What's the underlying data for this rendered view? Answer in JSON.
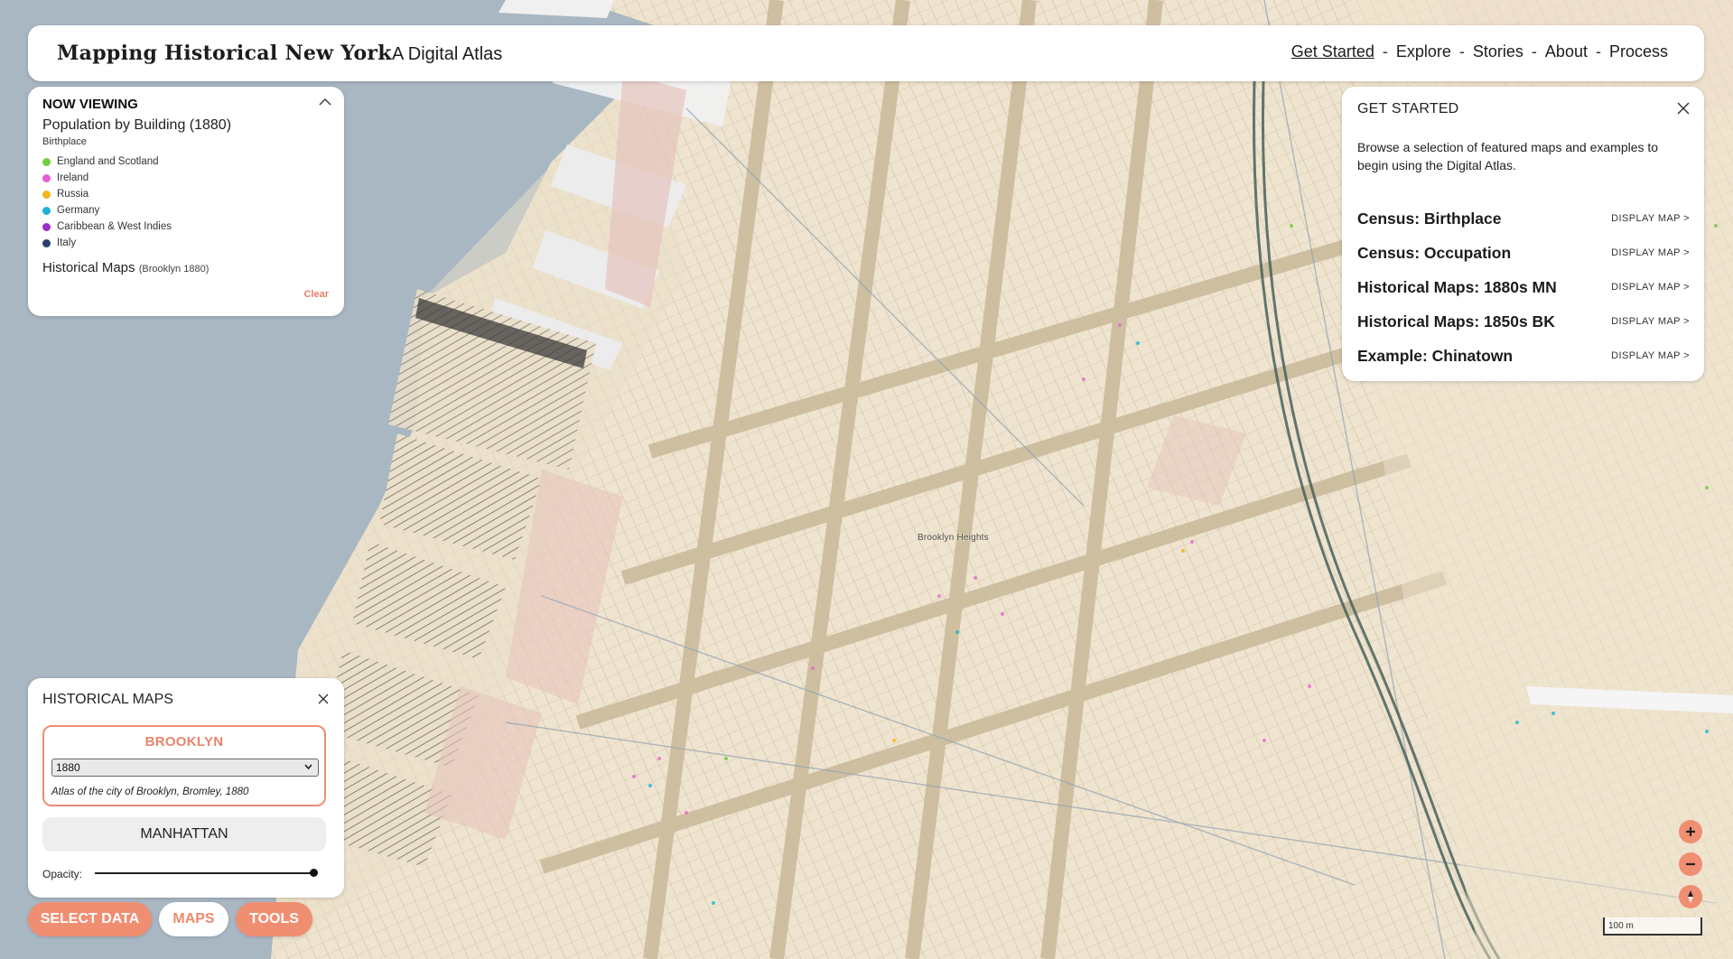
{
  "app": {
    "title": "Mapping Historical New York",
    "subtitle": "A Digital Atlas"
  },
  "nav": {
    "items": [
      "Get Started",
      "Explore",
      "Stories",
      "About",
      "Process"
    ],
    "separator": "-",
    "active_index": 0
  },
  "now_viewing": {
    "heading": "NOW VIEWING",
    "dataset": "Population by Building (1880)",
    "attribute": "Birthplace",
    "legend": [
      {
        "label": "England and Scotland",
        "color": "#6fcf3c"
      },
      {
        "label": "Ireland",
        "color": "#e85fd1"
      },
      {
        "label": "Russia",
        "color": "#f2b51b"
      },
      {
        "label": "Germany",
        "color": "#1fb3d6"
      },
      {
        "label": "Caribbean & West Indies",
        "color": "#9b2fce"
      },
      {
        "label": "Italy",
        "color": "#2d3d6e"
      }
    ],
    "maps_label": "Historical Maps",
    "maps_detail": "(Brooklyn 1880)",
    "clear_label": "Clear"
  },
  "get_started": {
    "heading": "GET STARTED",
    "description": "Browse a selection of featured maps and examples to begin using the Digital Atlas.",
    "action_label": "DISPLAY MAP >",
    "items": [
      "Census: Birthplace",
      "Census: Occupation",
      "Historical Maps: 1880s MN",
      "Historical Maps: 1850s BK",
      "Example: Chinatown"
    ]
  },
  "historical_maps": {
    "heading": "HISTORICAL MAPS",
    "brooklyn_label": "BROOKLYN",
    "selected_year": "1880",
    "source": "Atlas of the city of Brooklyn, Bromley, 1880",
    "manhattan_label": "MANHATTAN",
    "opacity_label": "Opacity:",
    "opacity": 1.0
  },
  "bottom_buttons": {
    "select_data": "SELECT DATA",
    "maps": "MAPS",
    "tools": "TOOLS"
  },
  "map": {
    "place_label": "Brooklyn Heights",
    "scale_label": "100 m"
  },
  "colors": {
    "accent": "#f08e72",
    "water": "#a9b7c3",
    "paper": "#efe6d2"
  }
}
